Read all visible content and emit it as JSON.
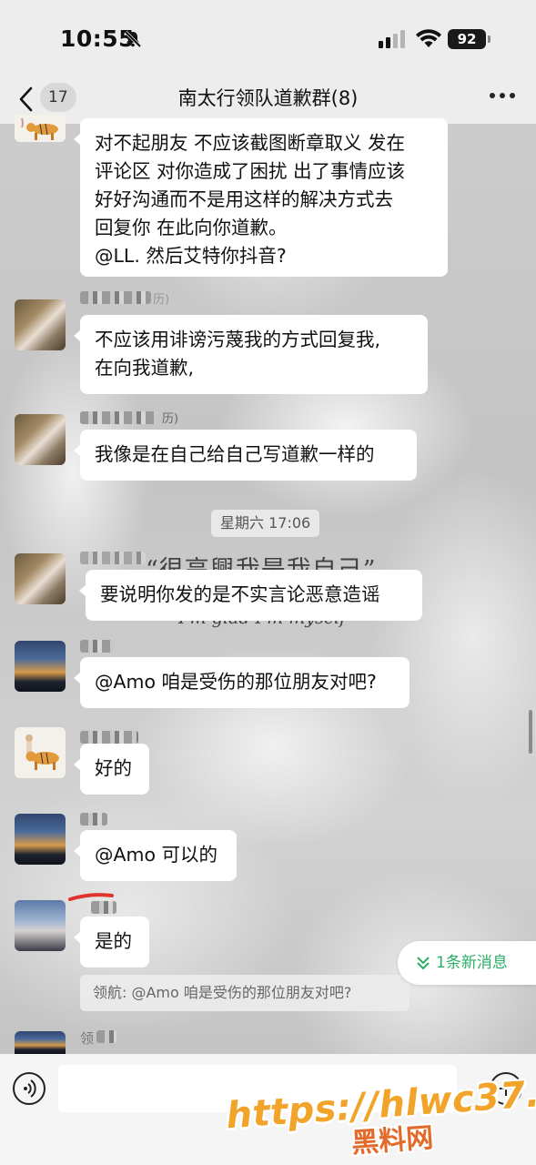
{
  "status_bar": {
    "time": "10:55",
    "battery": "92"
  },
  "nav": {
    "unread_count": "17",
    "title": "南太行领队道歉群(8)"
  },
  "messages": [
    {
      "text": "对不起朋友 不应该截图断章取义 发在\n评论区 对你造成了困扰 出了事情应该\n好好沟通而不是用这样的解决方式去\n回复你 在此向你道歉。\n@LL. 然后艾特你抖音?"
    },
    {
      "name_fragment": "历)",
      "text": "不应该用诽谤污蔑我的方式回复我,\n在向我道歉,"
    },
    {
      "name_fragment": "历)",
      "text": "我像是在自己给自己写道歉一样的"
    },
    {
      "text": "要说明你发的是不实言论恶意造谣"
    },
    {
      "text": "@Amo 咱是受伤的那位朋友对吧?"
    },
    {
      "text": "好的"
    },
    {
      "text": "@Amo 可以的"
    },
    {
      "text": "是的"
    }
  ],
  "timestamp": "星期六 17:06",
  "quote": "领航: @Amo 咱是受伤的那位朋友对吧?",
  "last_sender_fragment": "领",
  "new_messages": "1条新消息",
  "background_quote": {
    "line1": "“很高興我是我自己”",
    "line2": "I'm glad I'm myself"
  },
  "watermark": {
    "url": "https://hlwc37.com",
    "site": "黑料网"
  },
  "colors": {
    "accent_green": "#2bae66",
    "watermark_orange": "#f2a32a",
    "bubble": "#ffffff"
  }
}
